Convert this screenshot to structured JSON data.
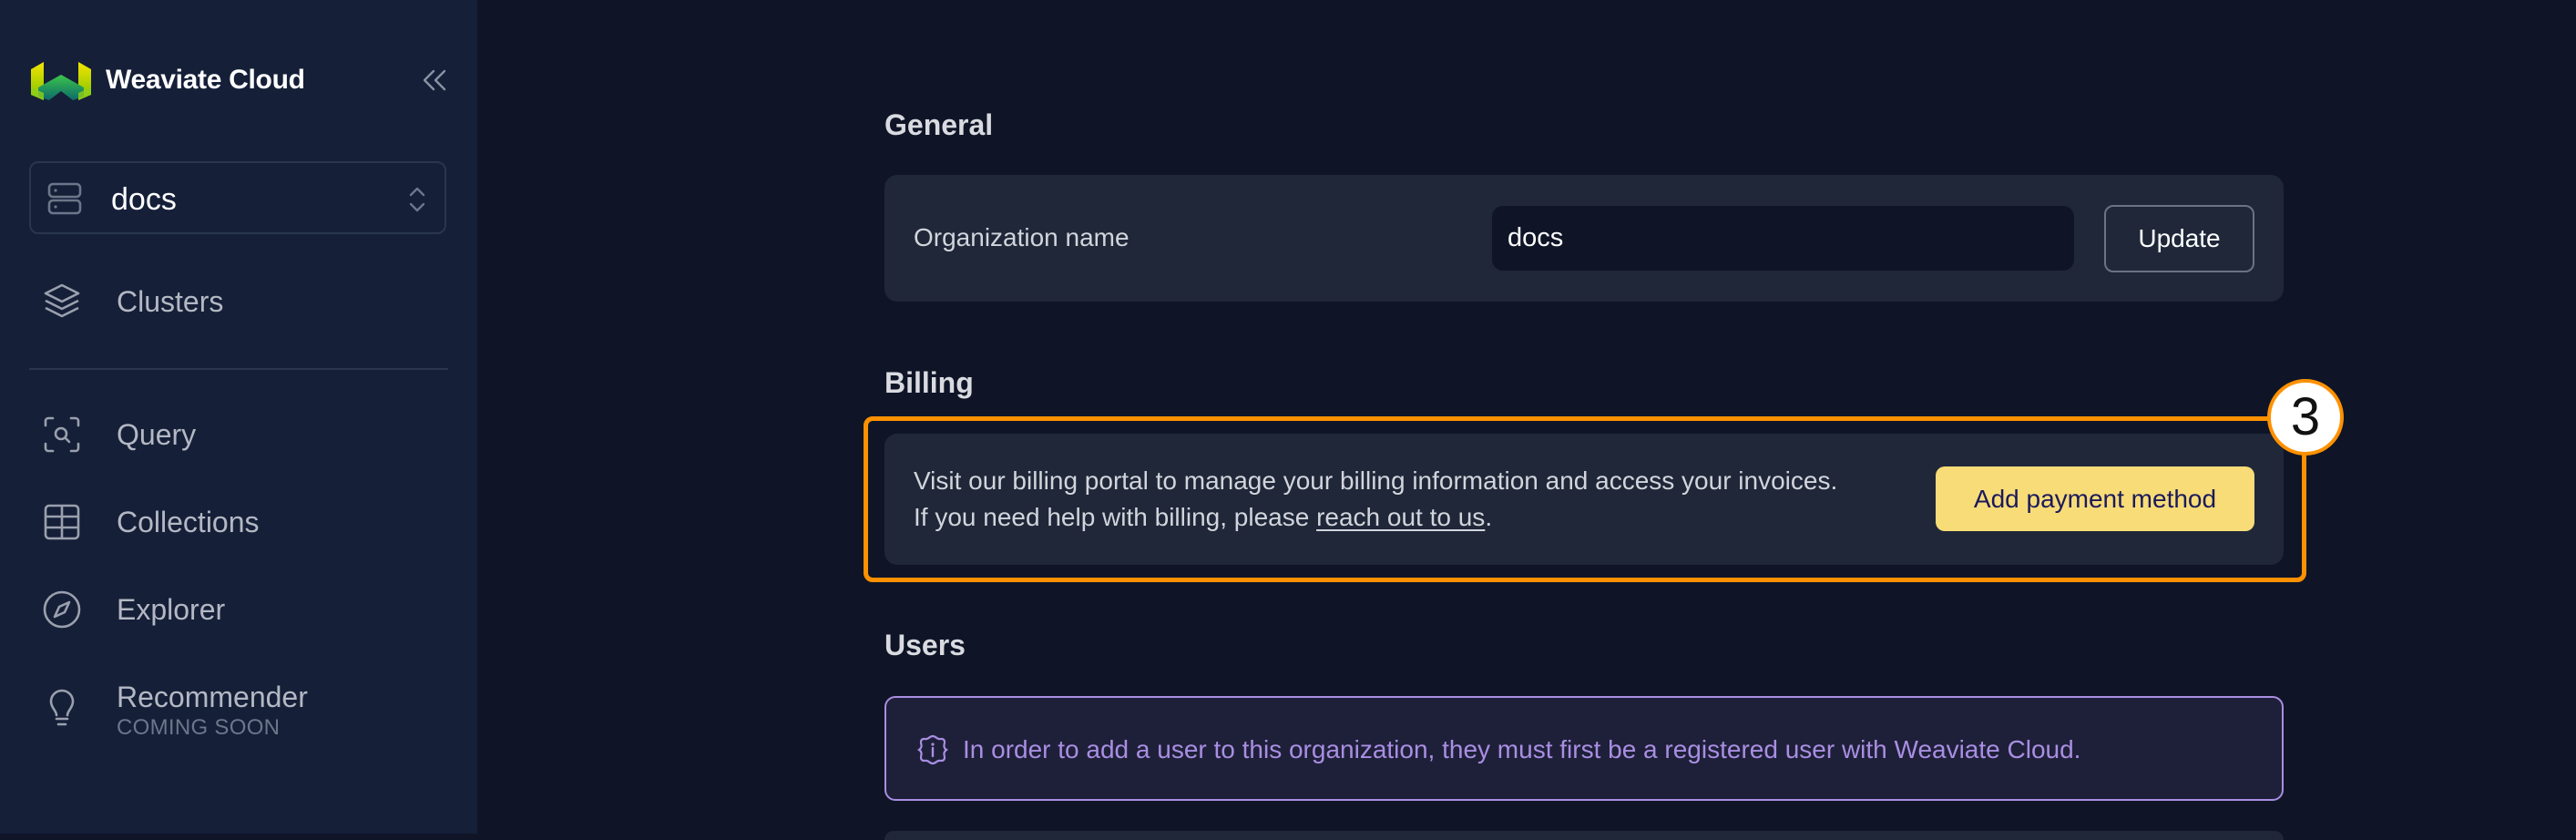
{
  "sidebar": {
    "brand": "Weaviate Cloud",
    "collapse_icon": "chevrons-left-icon",
    "org_selector": {
      "value": "docs",
      "icon": "server-icon",
      "chevron": "chevron-up-down-icon"
    },
    "items": [
      {
        "label": "Clusters",
        "icon": "layers-icon"
      },
      {
        "label": "Query",
        "icon": "scan-search-icon"
      },
      {
        "label": "Collections",
        "icon": "table-icon"
      },
      {
        "label": "Explorer",
        "icon": "compass-icon"
      },
      {
        "label": "Recommender",
        "sublabel": "COMING SOON",
        "icon": "lightbulb-icon"
      }
    ]
  },
  "main": {
    "general": {
      "title": "General",
      "org_label": "Organization name",
      "org_value": "docs",
      "update_label": "Update"
    },
    "billing": {
      "title": "Billing",
      "line1": "Visit our billing portal to manage your billing information and access your invoices.",
      "line2_prefix": "If you need help with billing, please ",
      "link": "reach out to us",
      "line2_suffix": ".",
      "button": "Add payment method"
    },
    "users": {
      "title": "Users",
      "info": "In order to add a user to this organization, they must first be a registered user with Weaviate Cloud.",
      "info_icon": "info-badge-icon"
    }
  },
  "annotation": {
    "step": "3",
    "color": "#ff9100"
  },
  "colors": {
    "background": "#0f1527",
    "sidebar": "#151f38",
    "card": "#1f2739",
    "accent_yellow": "#f8dc77",
    "info_purple": "#a98ee2"
  }
}
